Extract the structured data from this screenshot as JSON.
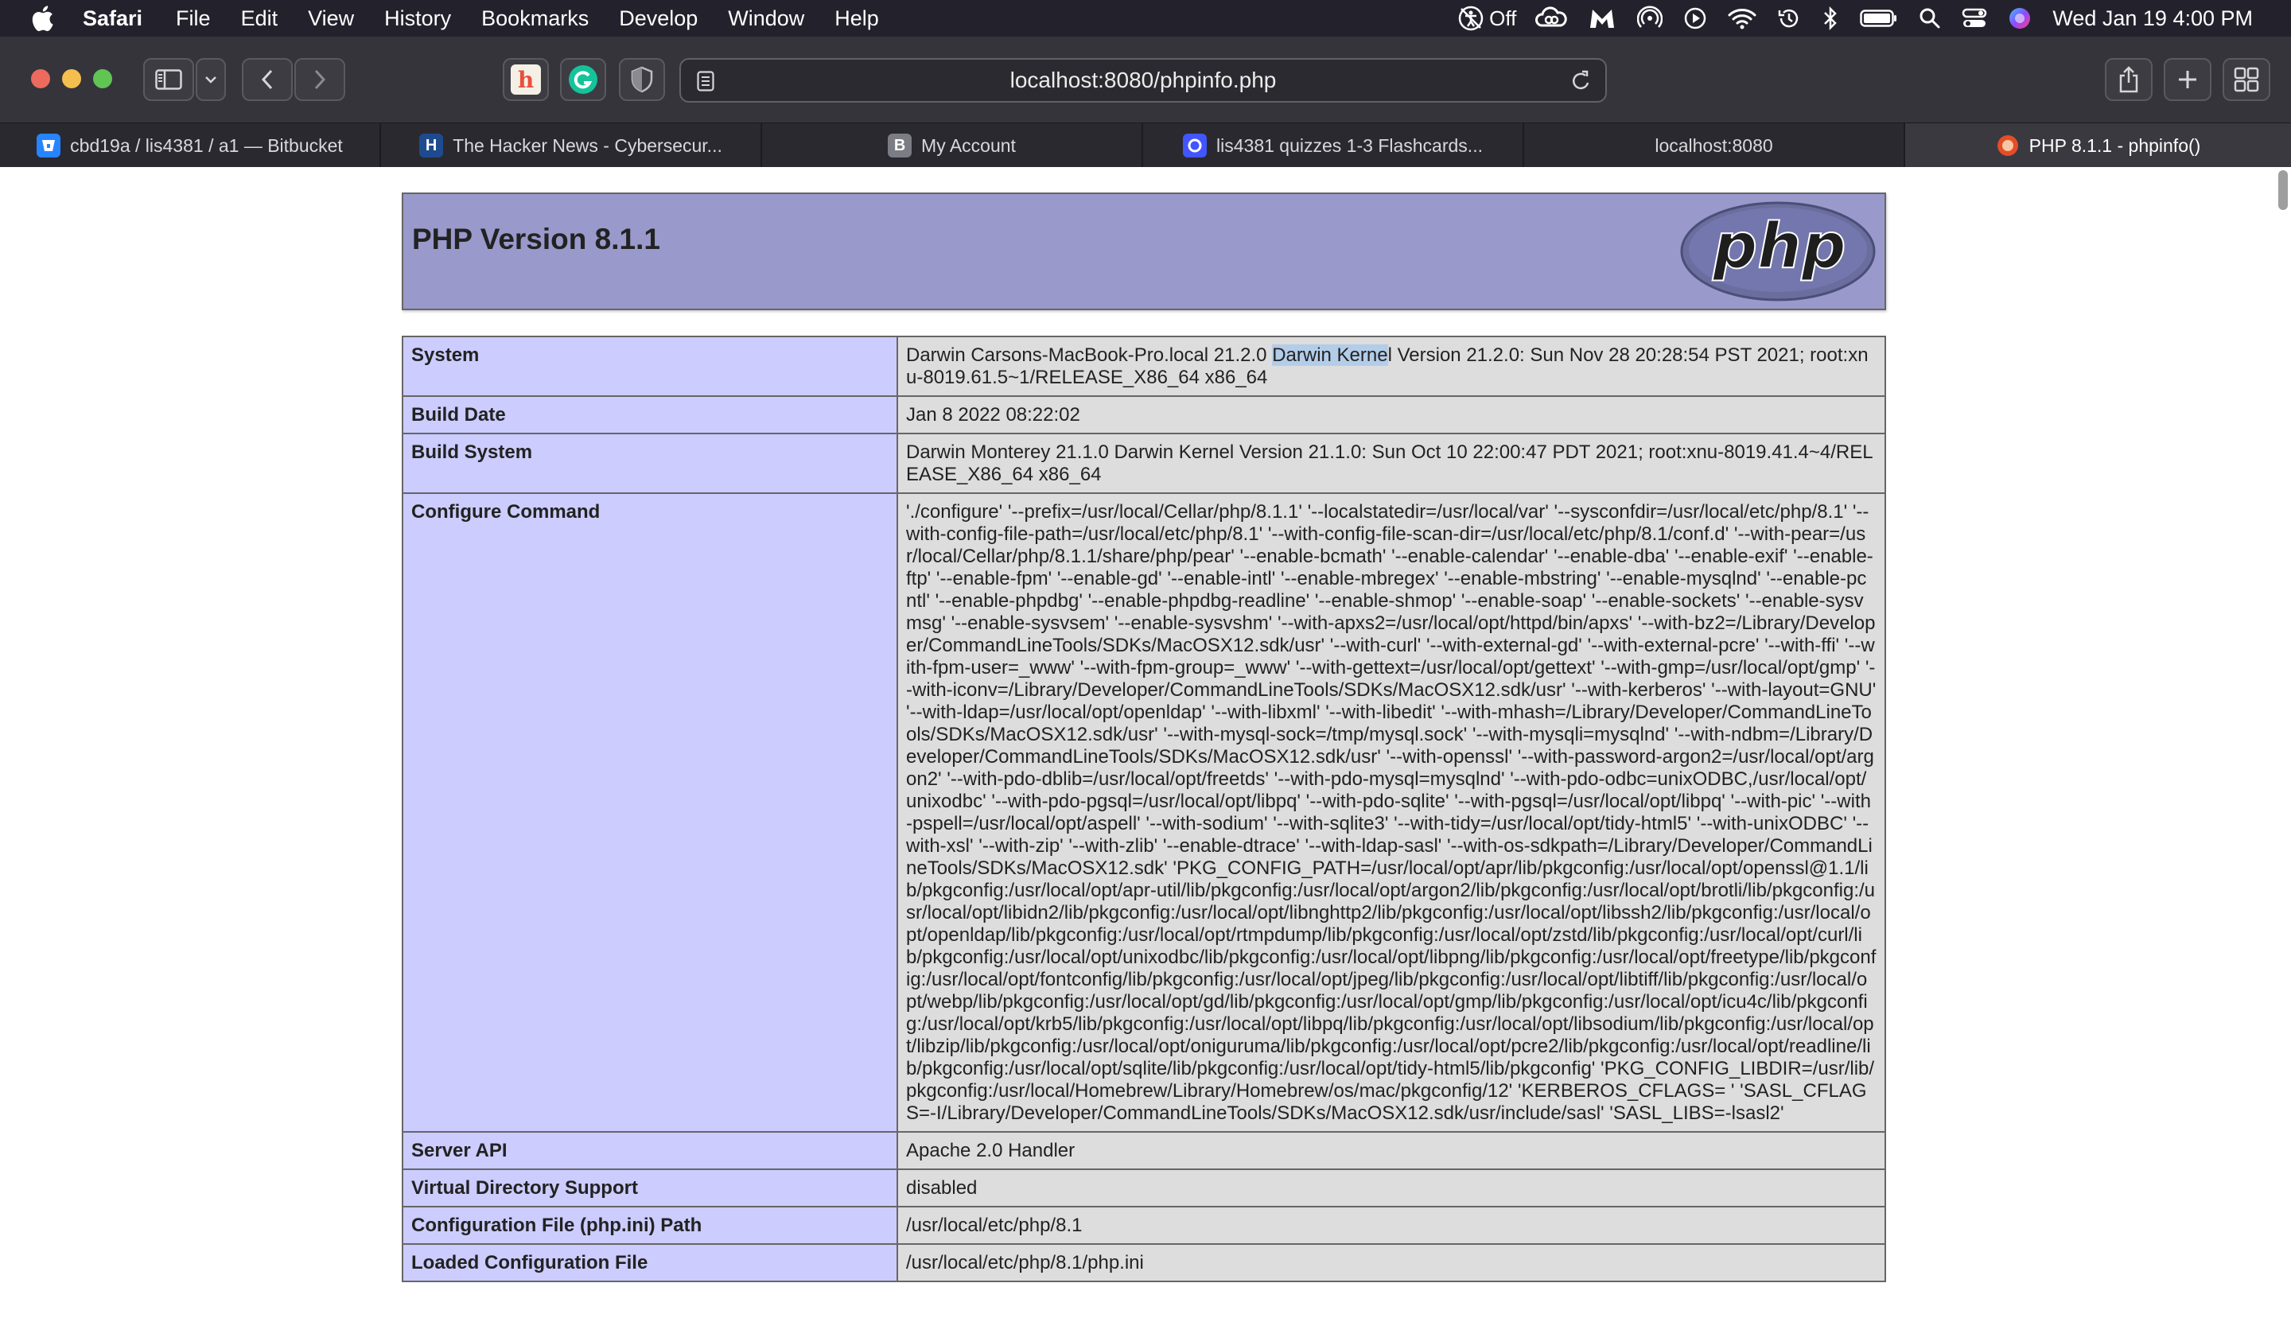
{
  "menubar": {
    "app_name": "Safari",
    "items": [
      "File",
      "Edit",
      "View",
      "History",
      "Bookmarks",
      "Develop",
      "Window",
      "Help"
    ],
    "status_off_label": "Off",
    "clock": "Wed Jan 19  4:00 PM"
  },
  "toolbar": {
    "url": "localhost:8080/phpinfo.php"
  },
  "tabs": [
    {
      "label": "cbd19a / lis4381 / a1 — Bitbucket",
      "icon": "bitbucket-icon",
      "color": "#2684ff"
    },
    {
      "label": "The Hacker News - Cybersecur...",
      "icon": "hacker-news-icon",
      "color": "#1e4b8f"
    },
    {
      "label": "My Account",
      "icon": "b-letter-icon",
      "color": "#7c7c85"
    },
    {
      "label": "lis4381 quizzes 1-3 Flashcards...",
      "icon": "quizlet-icon",
      "color": "#4255ff"
    },
    {
      "label": "localhost:8080",
      "icon": "",
      "color": ""
    },
    {
      "label": "PHP 8.1.1 - phpinfo()",
      "icon": "php-favicon-icon",
      "color": "#e44d26"
    }
  ],
  "php": {
    "version_title": "PHP Version 8.1.1",
    "logo_text": "php"
  },
  "info_rows": [
    {
      "key": "System",
      "value_before": "Darwin Carsons-MacBook-Pro.local 21.2.0 ",
      "value_highlight": "Darwin Kerne",
      "value_after": "l Version 21.2.0: Sun Nov 28 20:28:54 PST 2021; root:xnu-8019.61.5~1/RELEASE_X86_64 x86_64"
    },
    {
      "key": "Build Date",
      "value": "Jan 8 2022 08:22:02"
    },
    {
      "key": "Build System",
      "value": "Darwin Monterey 21.1.0 Darwin Kernel Version 21.1.0: Sun Oct 10 22:00:47 PDT 2021; root:xnu-8019.41.4~4/RELEASE_X86_64 x86_64"
    },
    {
      "key": "Configure Command",
      "value": "'./configure' '--prefix=/usr/local/Cellar/php/8.1.1' '--localstatedir=/usr/local/var' '--sysconfdir=/usr/local/etc/php/8.1' '--with-config-file-path=/usr/local/etc/php/8.1' '--with-config-file-scan-dir=/usr/local/etc/php/8.1/conf.d' '--with-pear=/usr/local/Cellar/php/8.1.1/share/php/pear' '--enable-bcmath' '--enable-calendar' '--enable-dba' '--enable-exif' '--enable-ftp' '--enable-fpm' '--enable-gd' '--enable-intl' '--enable-mbregex' '--enable-mbstring' '--enable-mysqlnd' '--enable-pcntl' '--enable-phpdbg' '--enable-phpdbg-readline' '--enable-shmop' '--enable-soap' '--enable-sockets' '--enable-sysvmsg' '--enable-sysvsem' '--enable-sysvshm' '--with-apxs2=/usr/local/opt/httpd/bin/apxs' '--with-bz2=/Library/Developer/CommandLineTools/SDKs/MacOSX12.sdk/usr' '--with-curl' '--with-external-gd' '--with-external-pcre' '--with-ffi' '--with-fpm-user=_www' '--with-fpm-group=_www' '--with-gettext=/usr/local/opt/gettext' '--with-gmp=/usr/local/opt/gmp' '--with-iconv=/Library/Developer/CommandLineTools/SDKs/MacOSX12.sdk/usr' '--with-kerberos' '--with-layout=GNU' '--with-ldap=/usr/local/opt/openldap' '--with-libxml' '--with-libedit' '--with-mhash=/Library/Developer/CommandLineTools/SDKs/MacOSX12.sdk/usr' '--with-mysql-sock=/tmp/mysql.sock' '--with-mysqli=mysqlnd' '--with-ndbm=/Library/Developer/CommandLineTools/SDKs/MacOSX12.sdk/usr' '--with-openssl' '--with-password-argon2=/usr/local/opt/argon2' '--with-pdo-dblib=/usr/local/opt/freetds' '--with-pdo-mysql=mysqlnd' '--with-pdo-odbc=unixODBC,/usr/local/opt/unixodbc' '--with-pdo-pgsql=/usr/local/opt/libpq' '--with-pdo-sqlite' '--with-pgsql=/usr/local/opt/libpq' '--with-pic' '--with-pspell=/usr/local/opt/aspell' '--with-sodium' '--with-sqlite3' '--with-tidy=/usr/local/opt/tidy-html5' '--with-unixODBC' '--with-xsl' '--with-zip' '--with-zlib' '--enable-dtrace' '--with-ldap-sasl' '--with-os-sdkpath=/Library/Developer/CommandLineTools/SDKs/MacOSX12.sdk' 'PKG_CONFIG_PATH=/usr/local/opt/apr/lib/pkgconfig:/usr/local/opt/openssl@1.1/lib/pkgconfig:/usr/local/opt/apr-util/lib/pkgconfig:/usr/local/opt/argon2/lib/pkgconfig:/usr/local/opt/brotli/lib/pkgconfig:/usr/local/opt/libidn2/lib/pkgconfig:/usr/local/opt/libnghttp2/lib/pkgconfig:/usr/local/opt/libssh2/lib/pkgconfig:/usr/local/opt/openldap/lib/pkgconfig:/usr/local/opt/rtmpdump/lib/pkgconfig:/usr/local/opt/zstd/lib/pkgconfig:/usr/local/opt/curl/lib/pkgconfig:/usr/local/opt/unixodbc/lib/pkgconfig:/usr/local/opt/libpng/lib/pkgconfig:/usr/local/opt/freetype/lib/pkgconfig:/usr/local/opt/fontconfig/lib/pkgconfig:/usr/local/opt/jpeg/lib/pkgconfig:/usr/local/opt/libtiff/lib/pkgconfig:/usr/local/opt/webp/lib/pkgconfig:/usr/local/opt/gd/lib/pkgconfig:/usr/local/opt/gmp/lib/pkgconfig:/usr/local/opt/icu4c/lib/pkgconfig:/usr/local/opt/krb5/lib/pkgconfig:/usr/local/opt/libpq/lib/pkgconfig:/usr/local/opt/libsodium/lib/pkgconfig:/usr/local/opt/libzip/lib/pkgconfig:/usr/local/opt/oniguruma/lib/pkgconfig:/usr/local/opt/pcre2/lib/pkgconfig:/usr/local/opt/readline/lib/pkgconfig:/usr/local/opt/sqlite/lib/pkgconfig:/usr/local/opt/tidy-html5/lib/pkgconfig' 'PKG_CONFIG_LIBDIR=/usr/lib/pkgconfig:/usr/local/Homebrew/Library/Homebrew/os/mac/pkgconfig/12' 'KERBEROS_CFLAGS= ' 'SASL_CFLAGS=-I/Library/Developer/CommandLineTools/SDKs/MacOSX12.sdk/usr/include/sasl' 'SASL_LIBS=-lsasl2'"
    },
    {
      "key": "Server API",
      "value": "Apache 2.0 Handler"
    },
    {
      "key": "Virtual Directory Support",
      "value": "disabled"
    },
    {
      "key": "Configuration File (php.ini) Path",
      "value": "/usr/local/etc/php/8.1"
    },
    {
      "key": "Loaded Configuration File",
      "value": "/usr/local/etc/php/8.1/php.ini"
    }
  ],
  "colors": {
    "header_bg": "#9999cc",
    "key_cell_bg": "#ccccff",
    "value_cell_bg": "#dddddd",
    "selection_highlight": "#b3cde9"
  }
}
